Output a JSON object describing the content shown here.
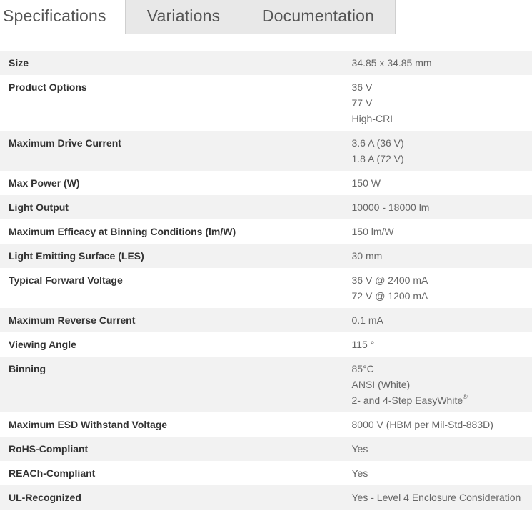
{
  "tabs": [
    {
      "label": "Specifications",
      "active": true
    },
    {
      "label": "Variations",
      "active": false
    },
    {
      "label": "Documentation",
      "active": false
    }
  ],
  "specs": [
    {
      "label": "Size",
      "values": [
        "34.85 x 34.85 mm"
      ]
    },
    {
      "label": "Product Options",
      "values": [
        "36 V",
        "77 V",
        "High-CRI"
      ]
    },
    {
      "label": "Maximum Drive Current",
      "values": [
        "3.6 A (36 V)",
        "1.8 A (72 V)"
      ]
    },
    {
      "label": "Max Power (W)",
      "values": [
        "150 W"
      ]
    },
    {
      "label": "Light Output",
      "values": [
        "10000 - 18000 lm"
      ]
    },
    {
      "label": "Maximum Efficacy at Binning Conditions (lm/W)",
      "values": [
        "150 lm/W"
      ]
    },
    {
      "label": "Light Emitting Surface (LES)",
      "values": [
        "30 mm"
      ]
    },
    {
      "label": "Typical Forward Voltage",
      "values": [
        "36 V @ 2400 mA",
        "72 V @ 1200 mA"
      ]
    },
    {
      "label": "Maximum Reverse Current",
      "values": [
        "0.1 mA"
      ]
    },
    {
      "label": "Viewing Angle",
      "values": [
        "115 °"
      ]
    },
    {
      "label": "Binning",
      "values": [
        "85°C",
        "ANSI (White)",
        "2- and 4-Step EasyWhite"
      ],
      "superscript": "®"
    },
    {
      "label": "Maximum ESD Withstand Voltage",
      "values": [
        "8000 V (HBM per Mil-Std-883D)"
      ]
    },
    {
      "label": "RoHS-Compliant",
      "values": [
        "Yes"
      ]
    },
    {
      "label": "REACh-Compliant",
      "values": [
        "Yes"
      ]
    },
    {
      "label": "UL-Recognized",
      "values": [
        "Yes - Level 4 Enclosure Consideration"
      ]
    }
  ]
}
